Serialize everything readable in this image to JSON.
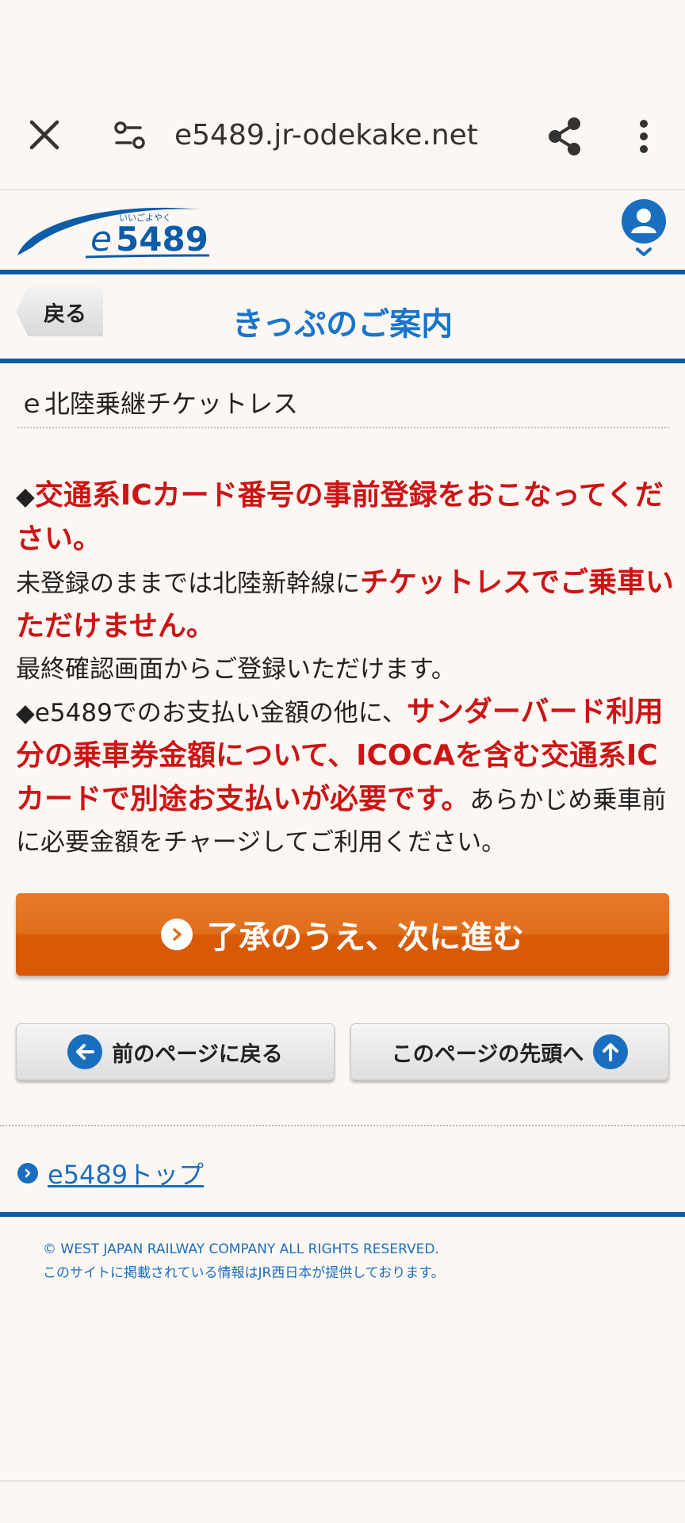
{
  "browser": {
    "url": "e5489.jr-odekake.net",
    "icons": {
      "close": "close-icon",
      "tune": "page-info-icon",
      "share": "share-icon",
      "more": "more-vert-icon"
    }
  },
  "header": {
    "logo_text": "e5489",
    "logo_ruby": "いいごよやく",
    "user_icon": "user-account-icon"
  },
  "title_bar": {
    "back_label": "戻る",
    "title": "きっぷのご案内"
  },
  "section": {
    "title": "ｅ北陸乗継チケットレス"
  },
  "notice": {
    "p1_prefix": "◆",
    "p1_red": "交通系ICカード番号の事前登録をおこなってください。",
    "p2_text": "未登録のままでは北陸新幹線に",
    "p2_red": "チケットレスでご乗車いただけません。",
    "p3_text": "最終確認画面からご登録いただけます。",
    "p4_text": "◆e5489でのお支払い金額の他に、",
    "p4_red": "サンダーバード利用分の乗車券金額について、ICOCAを含む交通系ICカードで別途お支払いが必要です。",
    "p4_suffix": "あらかじめ乗車前に必要金額をチャージしてご利用ください。"
  },
  "buttons": {
    "primary": "了承のうえ、次に進む",
    "prev_page": "前のページに戻る",
    "page_top": "このページの先頭へ"
  },
  "links": {
    "top": "e5489トップ"
  },
  "footer": {
    "copyright": "© WEST JAPAN RAILWAY COMPANY ALL RIGHTS RESERVED.",
    "note": "このサイトに掲載されている情報はJR西日本が提供しております。"
  },
  "colors": {
    "brand_blue": "#0d5ca8",
    "title_blue": "#1a75c9",
    "alert_red": "#cc1414",
    "primary_orange": "#d95a06"
  }
}
